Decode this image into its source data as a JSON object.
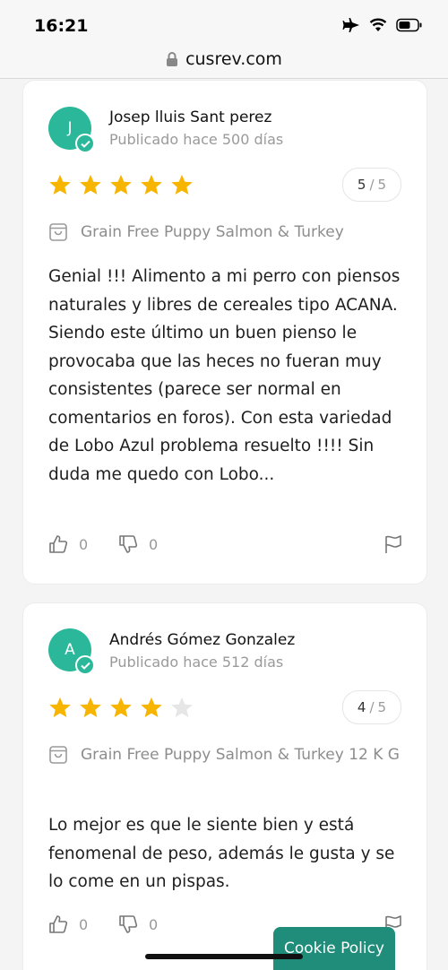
{
  "status_bar": {
    "time": "16:21"
  },
  "browser": {
    "url": "cusrev.com"
  },
  "reviews": [
    {
      "avatar_letter": "J",
      "author": "Josep lluis Sant perez",
      "date": "Publicado hace 500 días",
      "rating": 5,
      "rating_max": 5,
      "product": "Grain Free Puppy Salmon & Turkey",
      "text": "Genial !!! Alimento a mi perro con piensos naturales y libres de cereales tipo ACANA. Siendo este último un buen pienso le provocaba que las heces no fueran muy consistentes (parece ser normal en comentarios en foros). Con esta variedad de Lobo Azul problema resuelto !!!! Sin duda me quedo con Lobo...",
      "likes": "0",
      "dislikes": "0"
    },
    {
      "avatar_letter": "A",
      "author": "Andrés Gómez Gonzalez",
      "date": "Publicado hace 512 días",
      "rating": 4,
      "rating_max": 5,
      "product": "Grain Free Puppy Salmon & Turkey 12 K G",
      "text": "Lo mejor es que le siente bien y está fenomenal de peso, además le gusta y se lo come en un pispas.",
      "likes": "0",
      "dislikes": "0"
    }
  ],
  "cookie": {
    "label": "Cookie Policy"
  },
  "colors": {
    "accent": "#2bb89a",
    "star": "#f7b500",
    "star_empty": "#e6e6e6",
    "cookie_bg": "#1f8d79"
  }
}
